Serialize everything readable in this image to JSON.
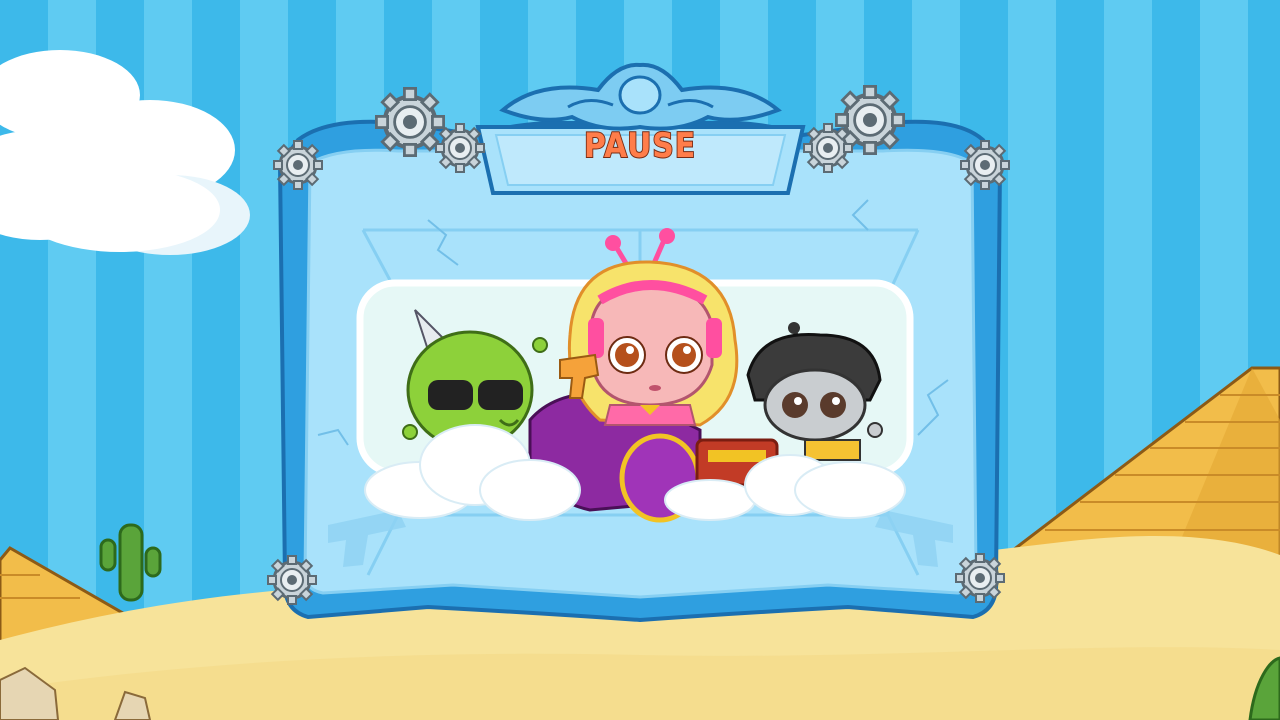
{
  "screen": "pause-menu",
  "pause_panel": {
    "title": "PAUSE",
    "characters": [
      "green-alien-with-sunglasses",
      "pink-haired-robot-girl",
      "gray-helmet-robot"
    ]
  },
  "palette": {
    "sky_stripe_dark": "#3db9ea",
    "sky_stripe_light": "#5fcbf2",
    "sand": "#f7e39a",
    "pyramid": "#f2bd4a",
    "panel_frame": "#2f9fe0",
    "panel_fill": "#a9e2fb",
    "title": "#ff7d4a"
  }
}
